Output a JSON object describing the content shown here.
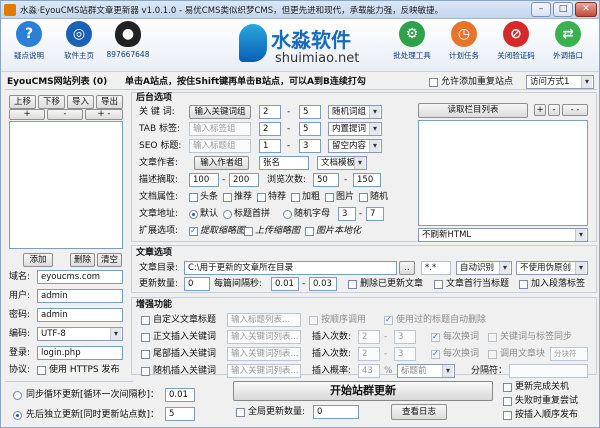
{
  "window": {
    "title": "水淼·EyouCMS站群文章更新器 v1.0.1.0 - 易优CMS类似织梦CMS，但更先进和现代，承载能力强，反映敏捷。",
    "btn_min": "–",
    "btn_max": "□",
    "btn_close": "✕"
  },
  "toolbar": {
    "help": "疑点说明",
    "home": "软件主页",
    "qq": "897667648",
    "logo_cn": "水淼软件",
    "logo_en": "shuimiao.net",
    "batch": "批处理工具",
    "schedule": "计划任务",
    "close_verify": "关闭验证码",
    "plugin": "外调插口"
  },
  "left": {
    "list_title": "EyouCMS网站列表 (0)",
    "hint": "单击A站点，按住Shift键再单击B站点，可以A到B连续打勾",
    "up": "上移",
    "down": "下移",
    "import": "导入",
    "export": "导出",
    "plus": "+",
    "minus": "-",
    "plusminus": "+ -",
    "add": "添加",
    "delete": "删除",
    "clear": "清空",
    "domain_label": "域名:",
    "domain_value": "eyoucms.com",
    "user_label": "用户:",
    "user_value": "admin",
    "pass_label": "密码:",
    "pass_value": "admin",
    "encoding_label": "编码:",
    "encoding_value": "UTF-8",
    "login_label": "登录:",
    "login_value": "login.php",
    "protocol_label": "协议:",
    "https_label": "使用 HTTPS 发布",
    "loop_label": "同步循环更新[循环一次间隔秒]：",
    "loop_value": "0.01",
    "independent_label": "先后独立更新[同时更新站点数]：",
    "independent_value": "5"
  },
  "top_right": {
    "allow_dup": "允许添加重复站点",
    "access_mode": "访问方式1"
  },
  "backend": {
    "section": "后台选项",
    "keyword_label": "关 键 词:",
    "keyword_btn": "输入关键词组",
    "keyword_min": "2",
    "keyword_max": "5",
    "keyword_mode": "随机词组",
    "tag_label": "TAB 标签:",
    "tag_placeholder": "输入标签组",
    "tag_min": "2",
    "tag_max": "5",
    "tag_mode": "内置提词",
    "seo_label": "SEO 标题:",
    "seo_placeholder": "输入标题组",
    "seo_min": "1",
    "seo_max": "3",
    "seo_mode": "留空内容",
    "author_label": "文章作者:",
    "author_btn": "输入作者组",
    "author_value": "张名",
    "template": "文档模板",
    "desc_label": "描述摘取:",
    "desc_min": "100",
    "desc_max": "200",
    "views_label": "浏览次数:",
    "views_min": "50",
    "views_max": "150",
    "attr_label": "文档属性:",
    "attrs": [
      "头条",
      "推荐",
      "特荐",
      "加粗",
      "图片",
      "随机"
    ],
    "url_label": "文章地址:",
    "url_default": "默认",
    "url_pinyin": "标题首拼",
    "url_random": "随机字母",
    "url_min": "3",
    "url_max": "7",
    "ext_label": "扩展选项:",
    "ext_thumb": "提取缩略图",
    "ext_upload": "上传缩略图",
    "ext_local": "图片本地化",
    "column_btn": "读取栏目列表",
    "plus": "+",
    "minus": "-",
    "dash": "- -",
    "editor_mode": "不刷新HTML"
  },
  "article": {
    "section": "文章选项",
    "dir_label": "文章目录:",
    "dir_value": "C:\\用于更新的文章所在目录",
    "browse": "..",
    "ext": "*.*",
    "encoding": "自动识别",
    "pseudo": "不使用伪原创",
    "count_label": "更新数量:",
    "count_value": "0",
    "interval_label": "每篇间隔秒:",
    "interval_min": "0.01",
    "interval_max": "0.03",
    "delete_updated": "删除已更新文章",
    "first_line_title": "文章首行当标题",
    "add_paragraph": "加入段落标签"
  },
  "enhance": {
    "section": "增强功能",
    "custom_title": "自定义文章标题",
    "custom_title_ph": "输入标题列表...",
    "rand_order": "按顺序调用",
    "use_title_del": "使用过的标题自动删除",
    "insert_kw": "正文插入关键词",
    "insert_kw_ph": "输入关键词列表...",
    "insert_count_label": "插入次数:",
    "insert_min": "2",
    "insert_max": "3",
    "per_line": "每次换词",
    "kw_sync": "关键词与标签同步",
    "tail_kw": "尾部插入关键词",
    "tail_kw_ph": "输入关键词列表...",
    "tail_count_label": "插入次数:",
    "tail_min": "2",
    "tail_max": "3",
    "tail_per_line": "每次换词",
    "call_block": "调用文章块",
    "block_ph": "分块符",
    "rand_kw": "随机插入关键词",
    "rand_kw_ph": "输入关键词列表...",
    "rand_rate_label": "插入概率:",
    "rand_rate": "43",
    "rand_rate_unit": "%",
    "rand_pos": "标题前",
    "sep_label": "分隔符：",
    "start": "开始站群更新",
    "view_log": "查看日志",
    "global_count_label": "全局更新数量:",
    "global_count": "0",
    "shutdown": "更新完成关机",
    "retry": "失败时重复尝试",
    "by_order": "按插入顺序发布"
  },
  "colors": {
    "accent": "#1769c2",
    "title_bg": "#c4d6ed"
  }
}
